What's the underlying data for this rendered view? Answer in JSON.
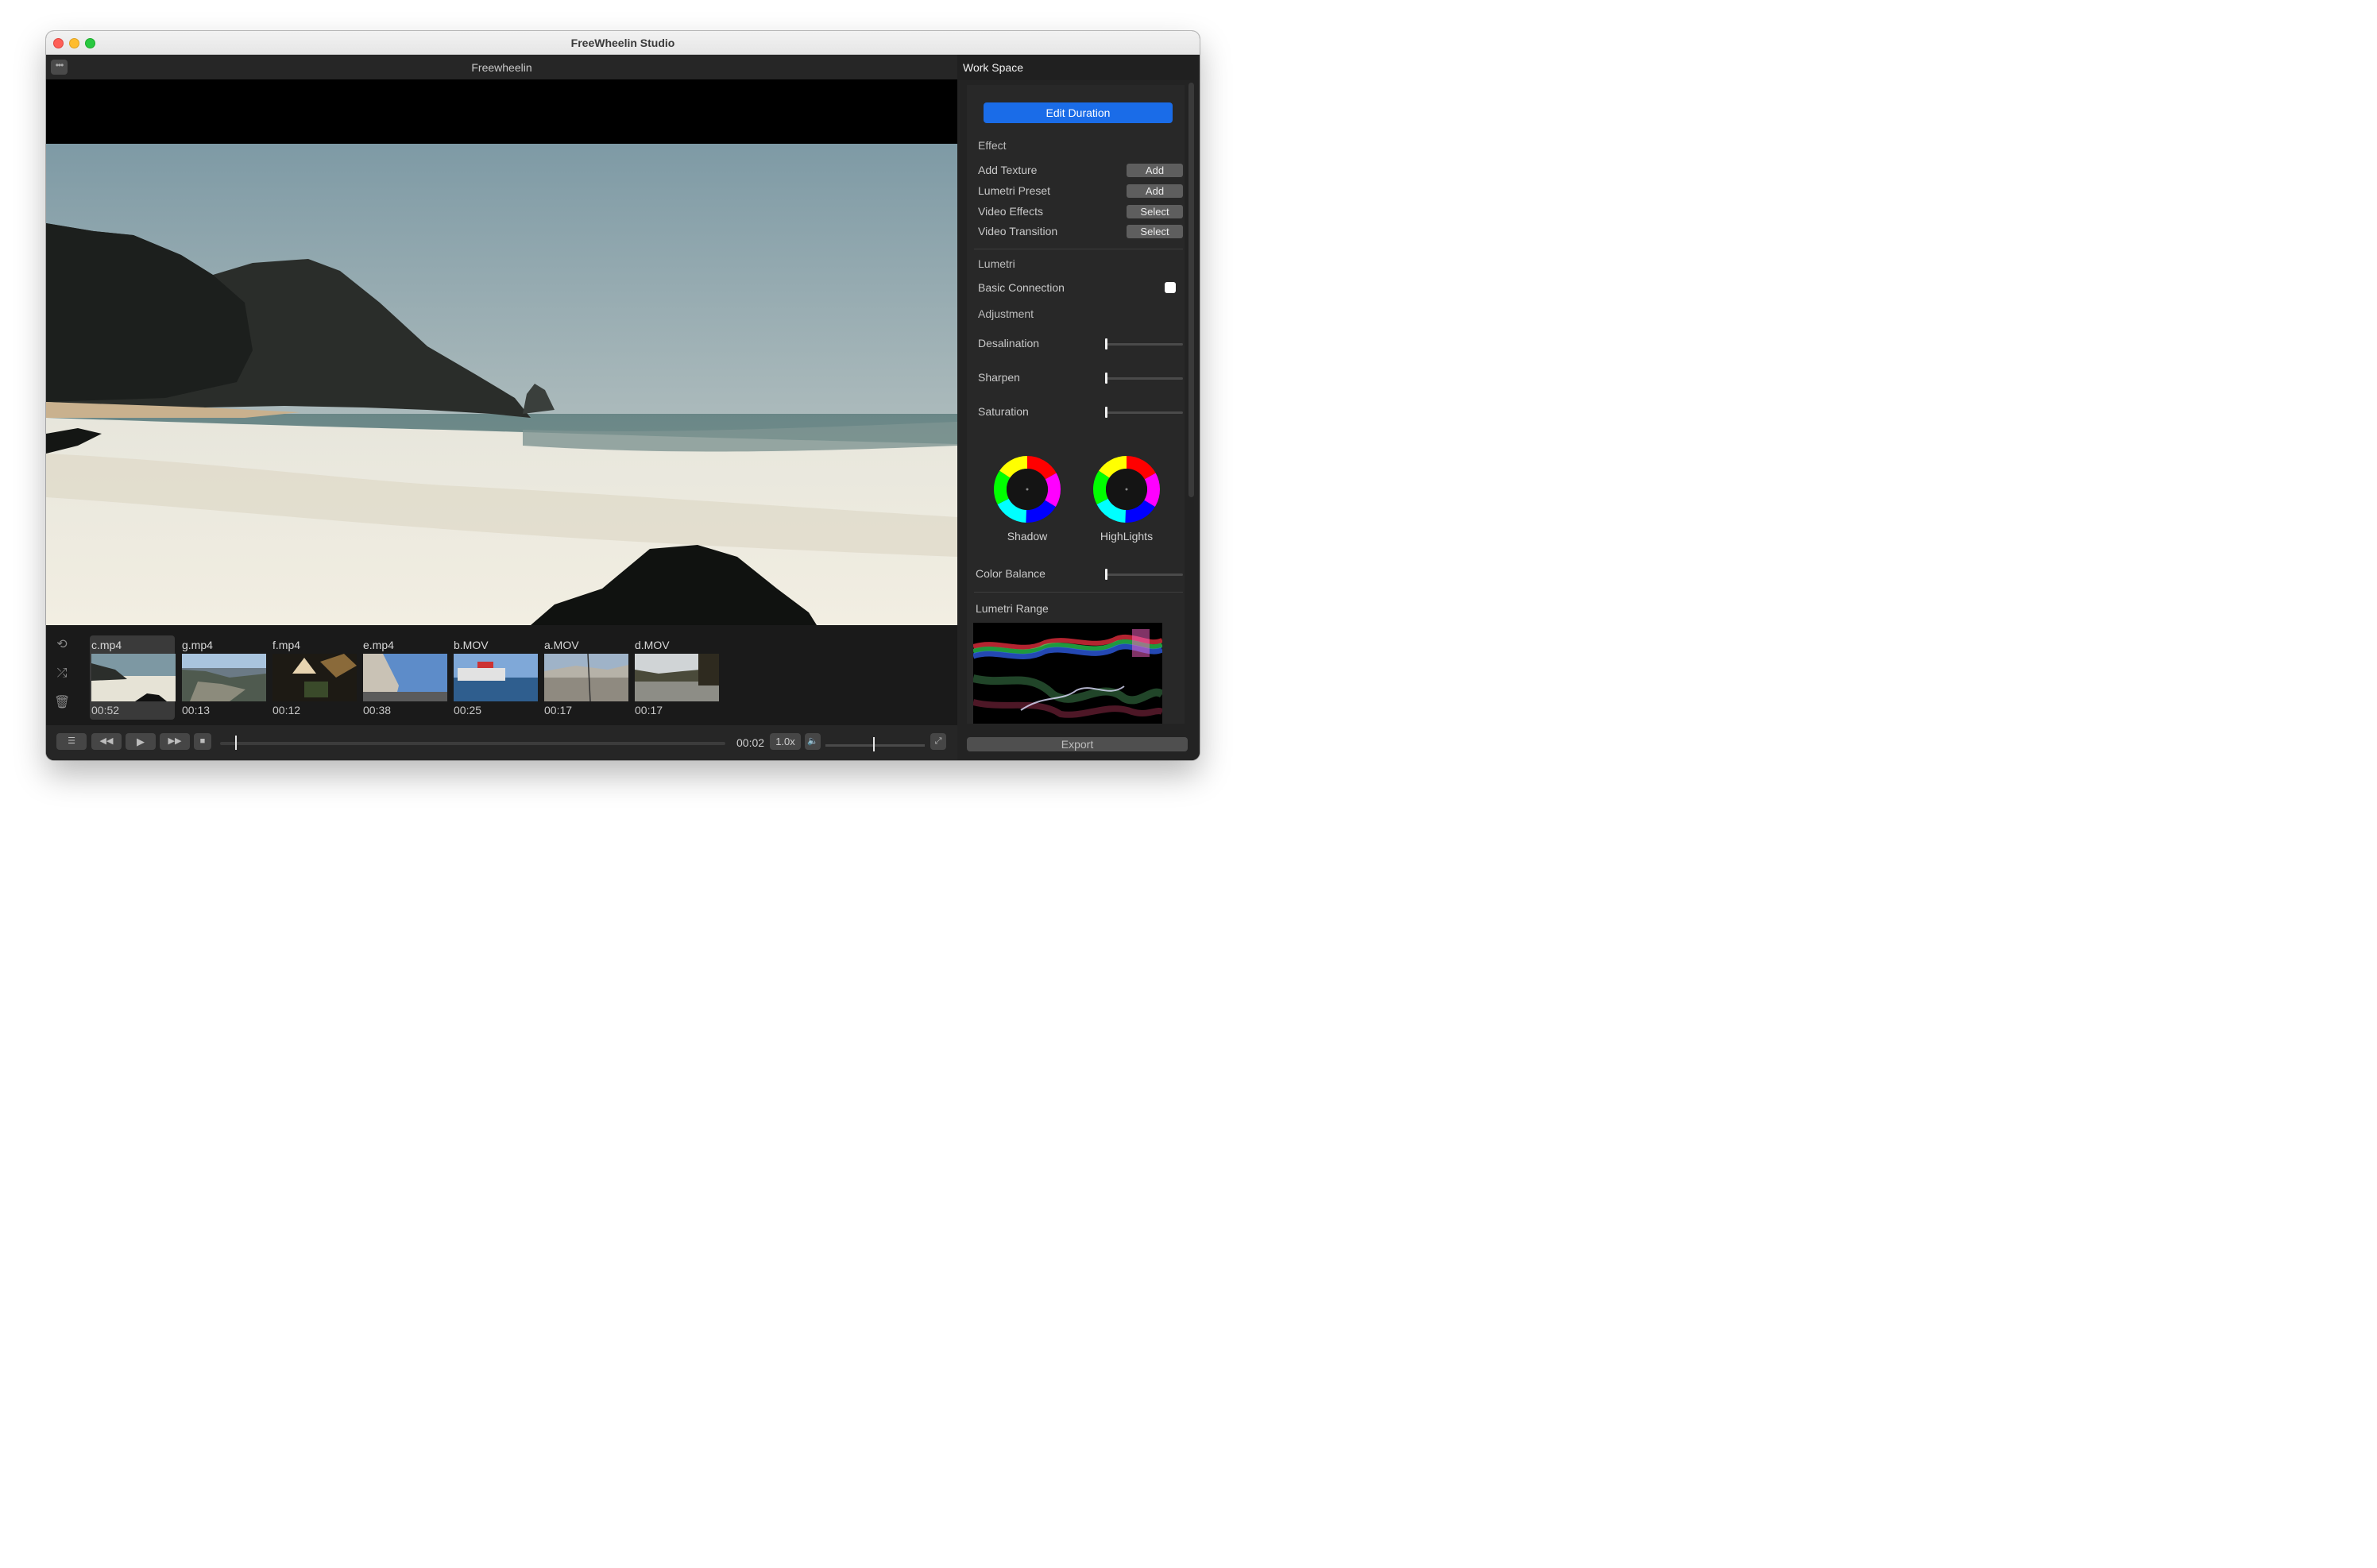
{
  "window": {
    "title": "FreeWheelin Studio"
  },
  "editor": {
    "project_title": "Freewheelin",
    "menu_glyph": "•••"
  },
  "clips": [
    {
      "name": "c.mp4",
      "duration": "00:52",
      "selected": true
    },
    {
      "name": "g.mp4",
      "duration": "00:13",
      "selected": false
    },
    {
      "name": "f.mp4",
      "duration": "00:12",
      "selected": false
    },
    {
      "name": "e.mp4",
      "duration": "00:38",
      "selected": false
    },
    {
      "name": "b.MOV",
      "duration": "00:25",
      "selected": false
    },
    {
      "name": "a.MOV",
      "duration": "00:17",
      "selected": false
    },
    {
      "name": "d.MOV",
      "duration": "00:17",
      "selected": false
    }
  ],
  "side_tools": {
    "loop_icon": "loop-icon",
    "shuffle_icon": "shuffle-icon",
    "trash_icon": "trash-icon"
  },
  "transport": {
    "current_time": "00:02",
    "playback_rate": "1.0x",
    "scrub_progress": 0.03,
    "volume_level": 0.48
  },
  "workspace": {
    "title": "Work Space",
    "edit_duration_label": "Edit Duration",
    "effect_heading": "Effect",
    "effects": [
      {
        "label": "Add Texture",
        "button": "Add"
      },
      {
        "label": "Lumetri Preset",
        "button": "Add"
      },
      {
        "label": "Video Effects",
        "button": "Select"
      },
      {
        "label": "Video Transition",
        "button": "Select"
      }
    ],
    "lumetri_heading": "Lumetri",
    "basic_connection_label": "Basic Connection",
    "basic_connection_checked": false,
    "adjustment_heading": "Adjustment",
    "adjustments": [
      {
        "label": "Desalination",
        "value": 0
      },
      {
        "label": "Sharpen",
        "value": 0
      },
      {
        "label": "Saturation",
        "value": 0
      }
    ],
    "wheels": [
      {
        "label": "Shadow"
      },
      {
        "label": "HighLights"
      }
    ],
    "color_balance_label": "Color Balance",
    "color_balance_value": 0,
    "lumetri_range_label": "Lumetri Range",
    "export_label": "Export"
  },
  "colors": {
    "accent": "#1a6ce8",
    "window_bg": "#1e1e1e",
    "panel_bg": "#282828"
  }
}
